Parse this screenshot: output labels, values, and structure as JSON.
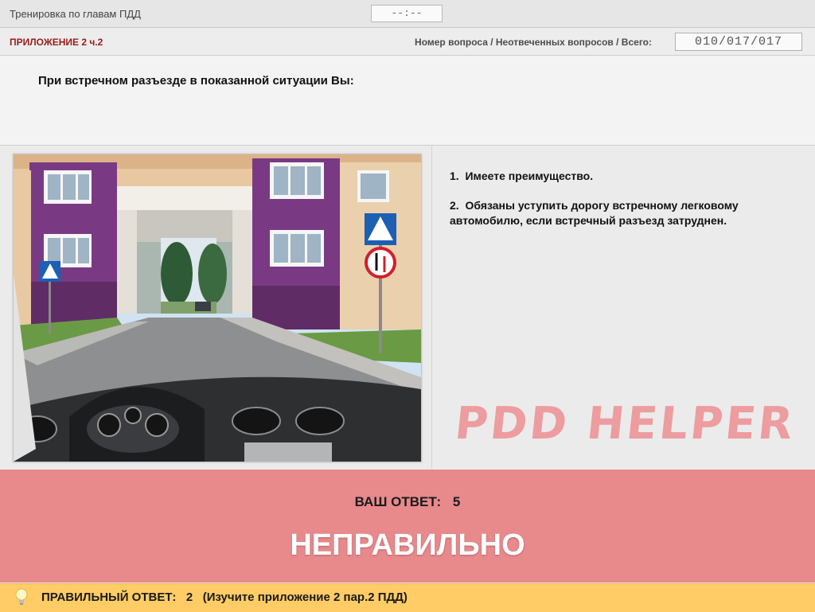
{
  "header": {
    "title": "Тренировка по главам ПДД",
    "timer": "--:--"
  },
  "info": {
    "section": "ПРИЛОЖЕНИЕ 2 ч.2",
    "counter_label": "Номер вопроса / Неотвеченных вопросов / Всего:",
    "counter_value": "010/017/017"
  },
  "question": {
    "text": "При встречном разъезде в показанной ситуации Вы:"
  },
  "answers": [
    {
      "num": "1.",
      "text": "Имеете преимущество."
    },
    {
      "num": "2.",
      "text": "Обязаны уступить дорогу встречному легковому автомобилю, если встречный разъезд затруднен."
    }
  ],
  "watermark": "PDD HELPER",
  "result": {
    "label": "ВАШ ОТВЕТ:",
    "value": "5",
    "verdict": "НЕПРАВИЛЬНО",
    "correct_label": "ПРАВИЛЬНЫЙ ОТВЕТ:",
    "correct_value": "2",
    "correct_note": "(Изучите приложение 2 пар.2 ПДД)"
  },
  "colors": {
    "section": "#9a1a1a",
    "result_bg": "#e8898c",
    "correct_bg": "#ffcc66",
    "watermark": "#ee8f92"
  }
}
